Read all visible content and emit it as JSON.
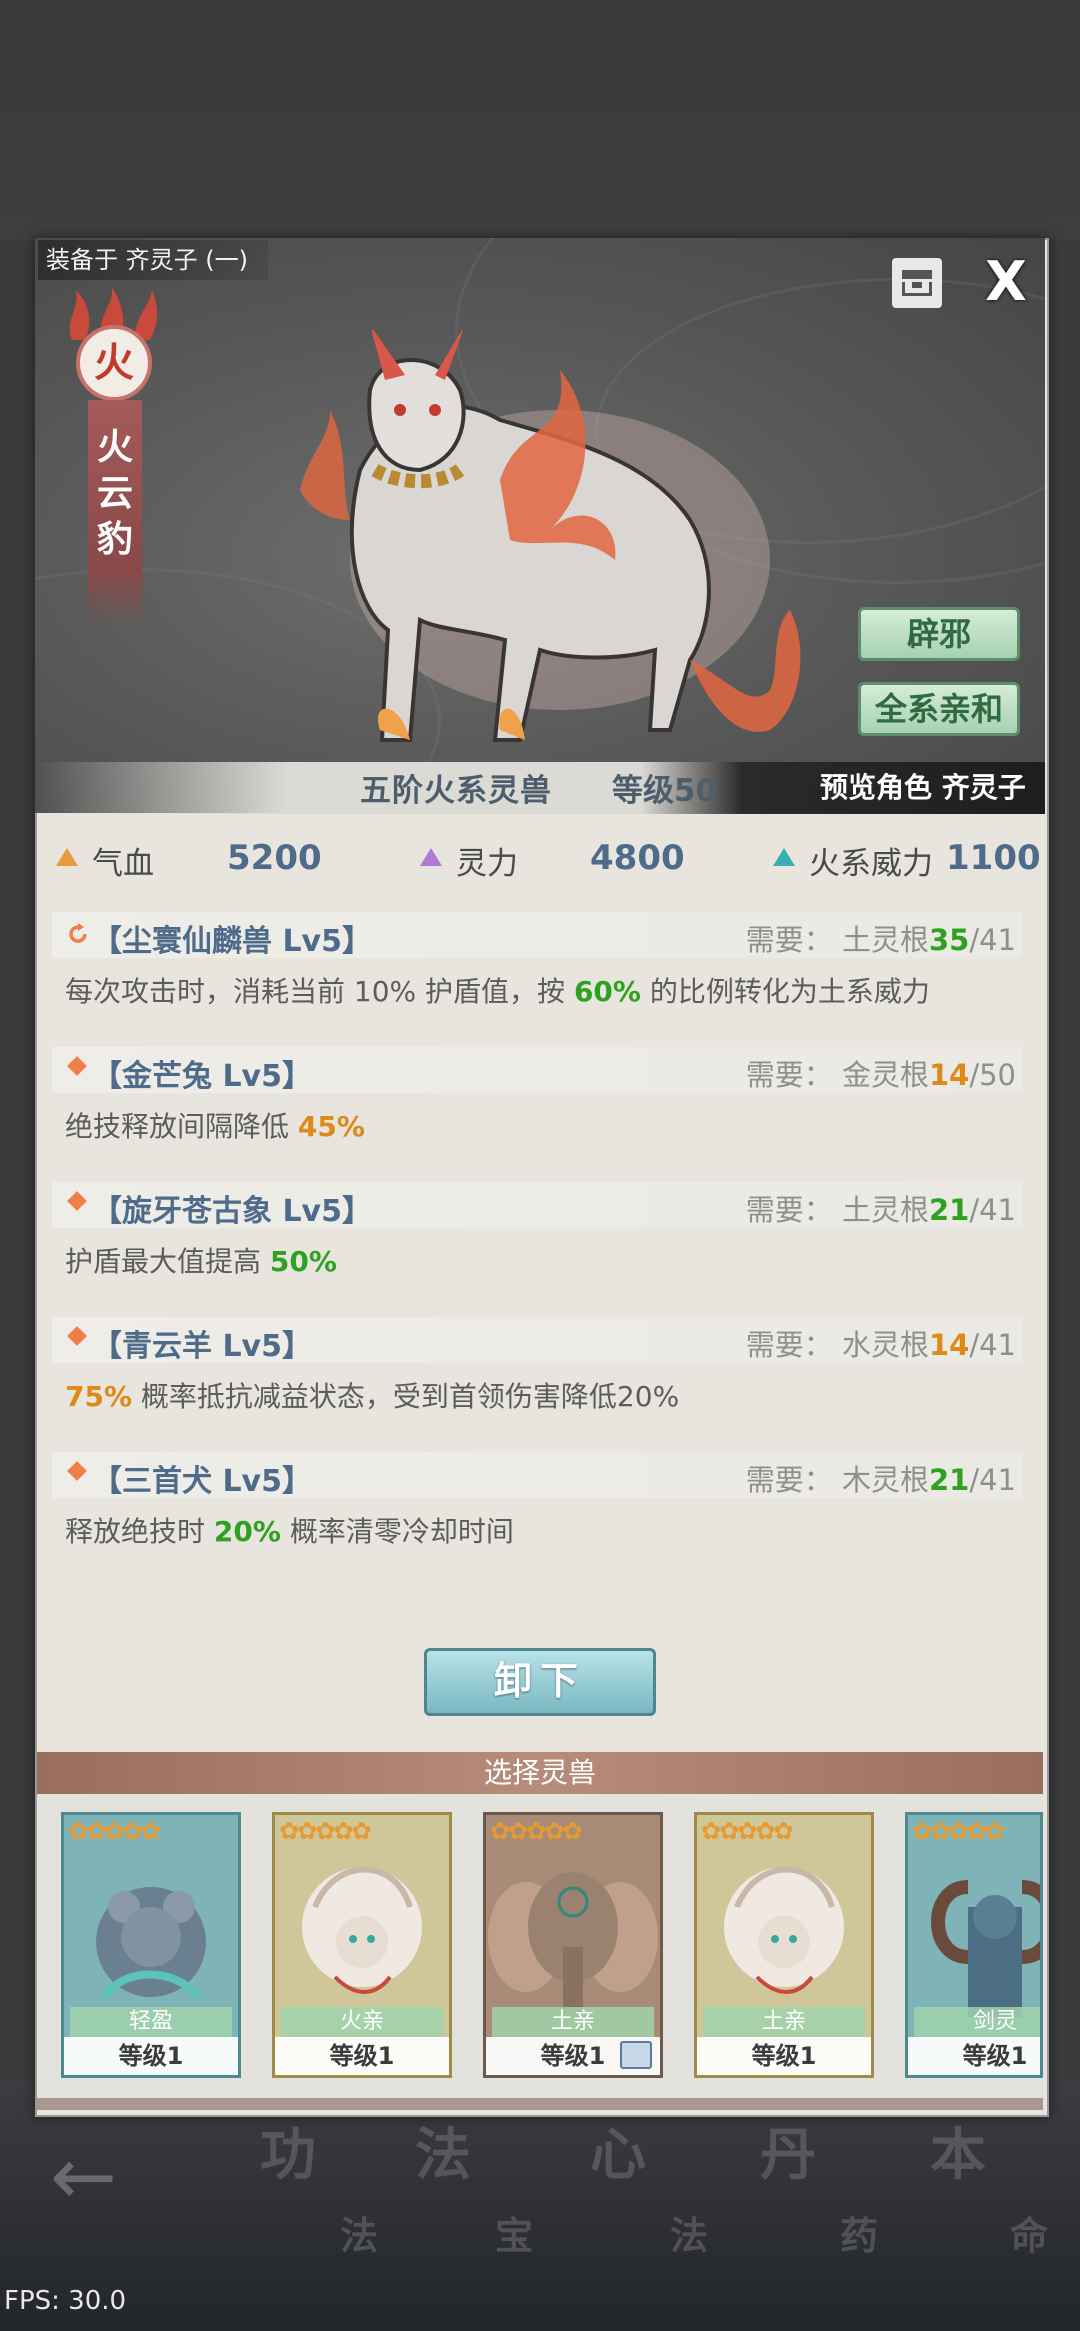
{
  "header": {
    "equipped_label": "装备于 齐灵子 (一)",
    "save_icon": "save-icon",
    "close_label": "X"
  },
  "pet": {
    "element": "火",
    "name_chars": [
      "火",
      "云",
      "豹"
    ],
    "rank": "五阶火系灵兽",
    "level": "等级50",
    "preview": "预览角色 齐灵子",
    "traits": [
      "辟邪",
      "全系亲和"
    ]
  },
  "stats": [
    {
      "label": "气血",
      "value": "5200",
      "color": "#e89a3c"
    },
    {
      "label": "灵力",
      "value": "4800",
      "color": "#b07ad0"
    },
    {
      "label": "火系威力",
      "value": "1100",
      "color": "#3aaeb0"
    }
  ],
  "skills": [
    {
      "name": "【尘寰仙麟兽 Lv5】",
      "req_prefix": "需要：  土灵根",
      "have": "35",
      "need": "/41",
      "have_color": "g",
      "desc_parts": [
        {
          "t": "每次攻击时，消耗当前 10% 护盾值，按 ",
          "c": ""
        },
        {
          "t": "60%",
          "c": "g"
        },
        {
          "t": " 的比例转化为土系威力",
          "c": ""
        }
      ],
      "icon": "refresh-icon"
    },
    {
      "name": "【金芒兔 Lv5】",
      "req_prefix": "需要：  金灵根",
      "have": "14",
      "need": "/50",
      "have_color": "o",
      "desc_parts": [
        {
          "t": "绝技释放间隔降低 ",
          "c": ""
        },
        {
          "t": "45%",
          "c": "o"
        }
      ],
      "icon": "diamond-icon"
    },
    {
      "name": "【旋牙苍古象 Lv5】",
      "req_prefix": "需要：  土灵根",
      "have": "21",
      "need": "/41",
      "have_color": "g",
      "desc_parts": [
        {
          "t": "护盾最大值提高 ",
          "c": ""
        },
        {
          "t": "50%",
          "c": "g"
        }
      ],
      "icon": "diamond-icon"
    },
    {
      "name": "【青云羊 Lv5】",
      "req_prefix": "需要：  水灵根",
      "have": "14",
      "need": "/41",
      "have_color": "o",
      "desc_parts": [
        {
          "t": "75%",
          "c": "o"
        },
        {
          "t": " 概率抵抗减益状态，受到首领伤害降低20%",
          "c": ""
        }
      ],
      "icon": "diamond-icon"
    },
    {
      "name": "【三首犬 Lv5】",
      "req_prefix": "需要：  木灵根",
      "have": "21",
      "need": "/41",
      "have_color": "g",
      "desc_parts": [
        {
          "t": "释放绝技时 ",
          "c": ""
        },
        {
          "t": "20%",
          "c": "g"
        },
        {
          "t": " 概率清零冷却时间",
          "c": ""
        }
      ],
      "icon": "diamond-icon"
    }
  ],
  "unequip_label": "卸下",
  "select_title": "选择灵兽",
  "cards": [
    {
      "trait": "轻盈",
      "level": "等级1",
      "border": "#4e8a92",
      "bg": "#7eb3b8",
      "beast": "rat"
    },
    {
      "trait": "火亲",
      "level": "等级1",
      "border": "#a08a48",
      "bg": "#cfc69a",
      "beast": "lion"
    },
    {
      "trait": "土亲",
      "level": "等级1",
      "border": "#6d5a4c",
      "bg": "#a88c78",
      "beast": "elephant"
    },
    {
      "trait": "土亲",
      "level": "等级1",
      "border": "#a08a48",
      "bg": "#cfc69a",
      "beast": "lion"
    },
    {
      "trait": "剑灵",
      "level": "等级1",
      "border": "#4e8a92",
      "bg": "#7eb3b8",
      "beast": "goat"
    }
  ],
  "bg_tabs": [
    {
      "big": "功",
      "small": "法"
    },
    {
      "big": "法",
      "small": "宝"
    },
    {
      "big": "心",
      "small": "法"
    },
    {
      "big": "丹",
      "small": "药"
    },
    {
      "big": "本",
      "small": "命"
    }
  ],
  "fps": "FPS: 30.0"
}
